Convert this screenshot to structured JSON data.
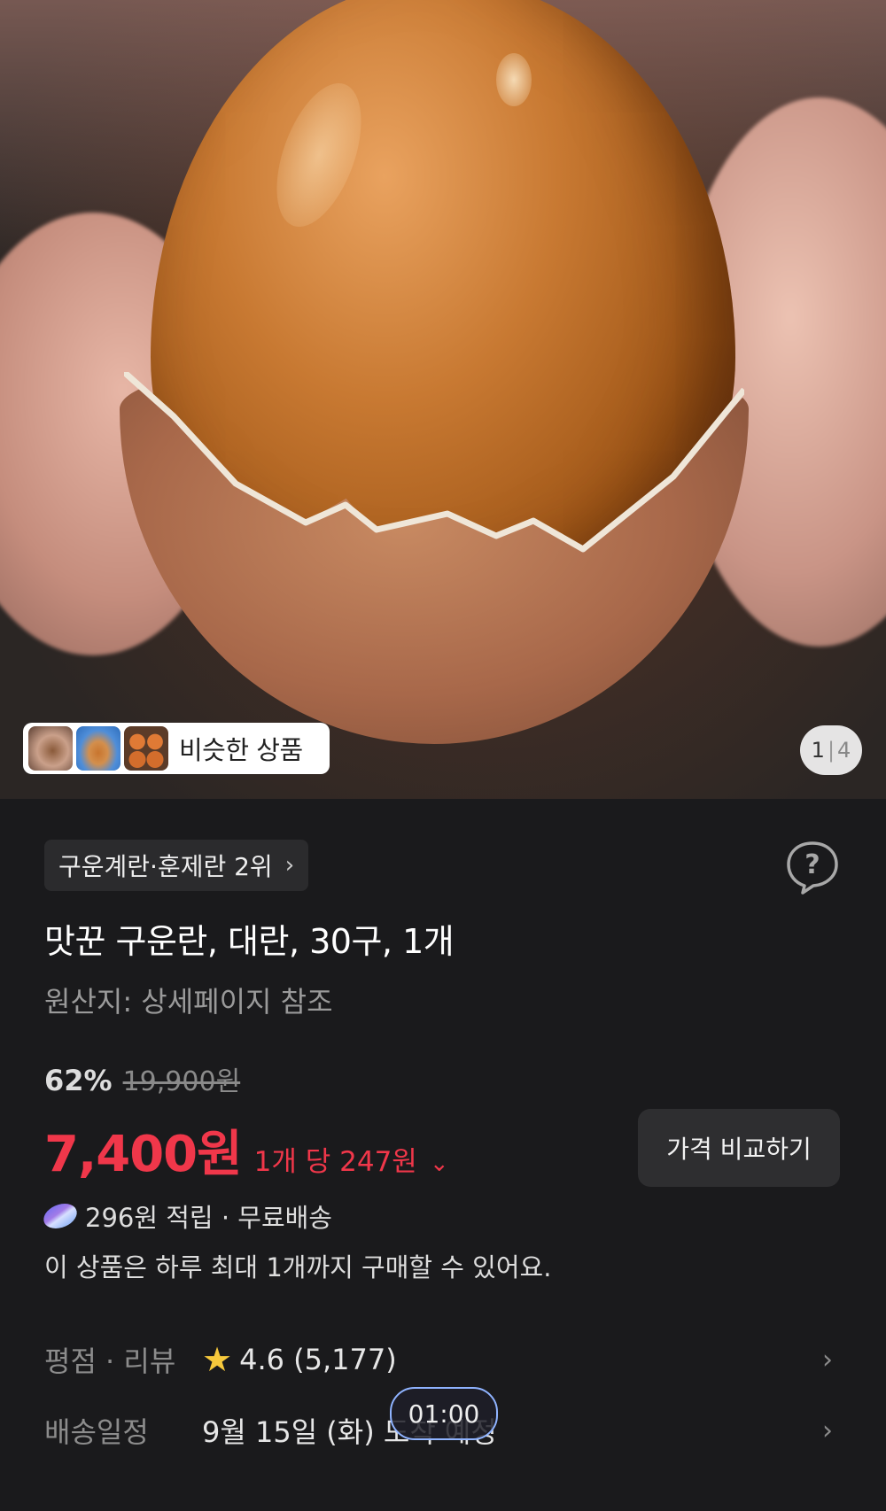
{
  "hero": {
    "similar_label": "비슷한 상품",
    "counter_current": "1",
    "counter_total": "4",
    "thumbnails": [
      "hand-holding-egg-thumb",
      "egg-sky-thumb",
      "eggs-pile-thumb"
    ]
  },
  "product": {
    "rank_chip": "구운계란·훈제란 2위",
    "title": "맛꾼 구운란, 대란, 30구, 1개",
    "origin": "원산지: 상세페이지 참조",
    "discount": "62%",
    "original_price": "19,900원",
    "price": "7,400원",
    "unit_price": "1개 당 247원",
    "compare_button": "가격 비교하기",
    "points": "296원 적립 · 무료배송",
    "purchase_limit": "이 상품은 하루 최대 1개까지 구매할 수 있어요."
  },
  "rating": {
    "label": "평점 · 리뷰",
    "value": "4.6 (5,177)"
  },
  "delivery": {
    "label": "배송일정",
    "value": "9월 15일 (화) 도착 예정"
  },
  "timer": "01:00",
  "colors": {
    "price_red": "#f0374a",
    "background": "#1a1a1c",
    "star": "#f7c93c"
  },
  "icons": [
    "chevron-right-icon",
    "help-icon",
    "star-icon",
    "chevron-down-icon",
    "coin-icon"
  ]
}
